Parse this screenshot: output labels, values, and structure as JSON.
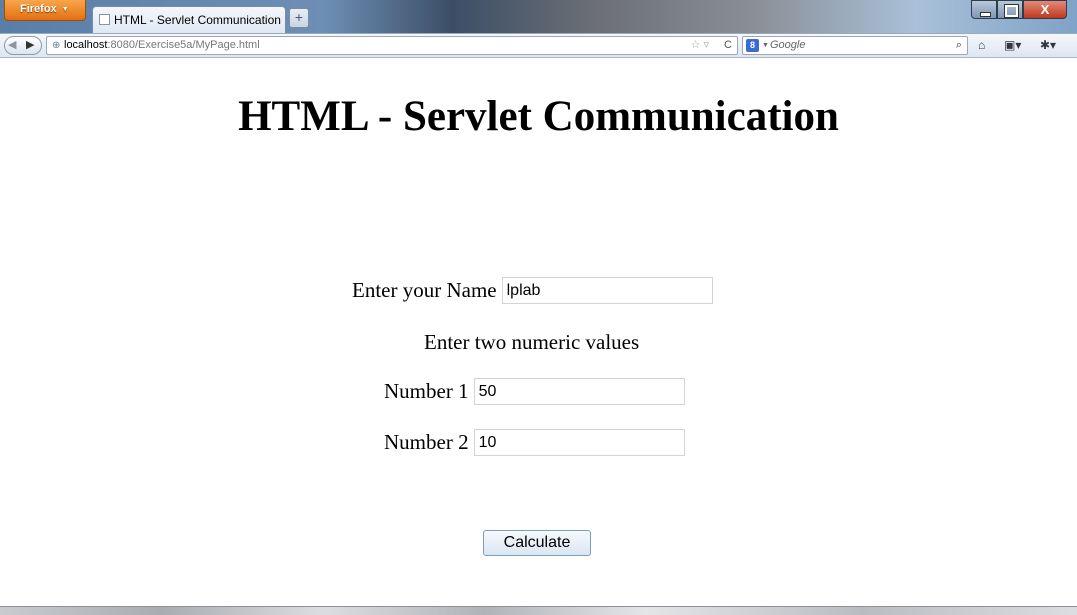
{
  "browser": {
    "menu_button": "Firefox",
    "tab_title": "HTML - Servlet Communication",
    "new_tab": "+",
    "url_host": "localhost",
    "url_rest": ":8080/Exercise5a/MyPage.html",
    "search_engine": "8",
    "search_placeholder": "Google",
    "close_glyph": "X"
  },
  "page": {
    "heading": "HTML - Servlet Communication",
    "name_label": "Enter your Name",
    "name_value": "lplab",
    "instruction": "Enter two numeric values",
    "number1_label": "Number 1",
    "number1_value": "50",
    "number2_label": "Number 2",
    "number2_value": "10",
    "calculate_label": "Calculate"
  },
  "colors": {
    "firefox_orange": "#e46f12",
    "title_bar": "#5a7ea8",
    "button_border": "#7a9cc3"
  }
}
